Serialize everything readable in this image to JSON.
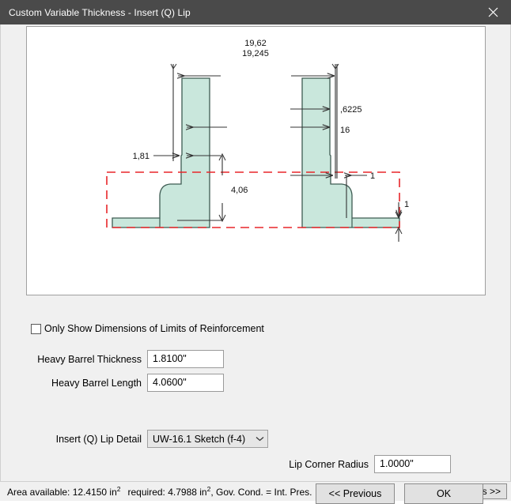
{
  "window": {
    "title": "Custom Variable Thickness - Insert (Q) Lip",
    "close_icon": "close-icon",
    "titlebar_color": "#4a4a4a",
    "body_color": "#f0f0f0"
  },
  "drawing": {
    "fill_color": "#c9e7dc",
    "outline_color": "#3d5b52",
    "limit_color": "#e8262a",
    "dimension_color": "#333333",
    "dimensions": {
      "overall_top_1": "19,62",
      "overall_top_2": "19,245",
      "lip_thickness_right": ",6225",
      "barrel_right": "16",
      "heavy_barrel_thickness": "1,81",
      "heavy_barrel_length": "4,06",
      "corner_radius_label": "1",
      "pad_thickness_label": "1"
    }
  },
  "options": {
    "only_show_limits_label": "Only Show Dimensions of Limits of Reinforcement",
    "only_show_limits_checked": false
  },
  "fields": {
    "heavy_barrel_thickness": {
      "label": "Heavy Barrel Thickness",
      "value": "1.8100\""
    },
    "heavy_barrel_length": {
      "label": "Heavy Barrel Length",
      "value": "4.0600\""
    },
    "lip_corner_radius": {
      "label": "Lip Corner Radius",
      "value": "1.0000\""
    }
  },
  "lip_detail": {
    "label": "Insert (Q) Lip Detail",
    "value": "UW-16.1 Sketch (f-4)",
    "arrow_icon": "chevron-down-icon"
  },
  "buttons": {
    "previous": "<< Previous",
    "ok": "OK",
    "details": "Details >>"
  },
  "status": {
    "area_available": "Area available: 12.4150 in",
    "area_available_sup": "2",
    "required": "required: 4.7988 in",
    "required_sup": "2",
    "gov_cond": ", Gov. Cond. = Int. Pres."
  }
}
